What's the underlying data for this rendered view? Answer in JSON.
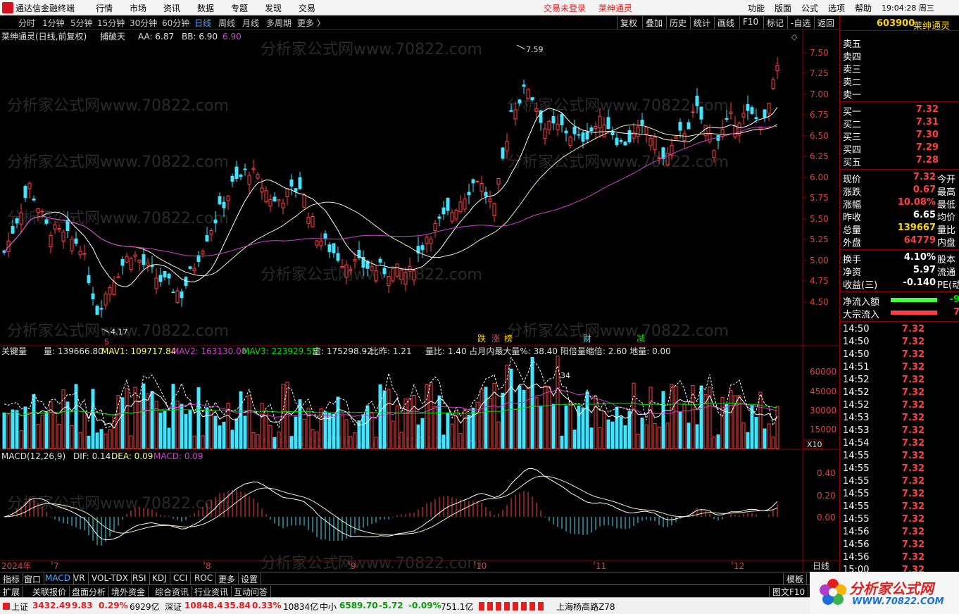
{
  "app": {
    "title": "通达信金融终端",
    "menu": [
      "行情",
      "市场",
      "资讯",
      "数据",
      "专题",
      "发现",
      "交易"
    ],
    "login_status": "交易未登录",
    "stock_name": "莱绅通灵",
    "right_menu": [
      "功能",
      "版面",
      "公式",
      "选项",
      "帮助"
    ],
    "time": "19:04:28",
    "weekday": "周三"
  },
  "toolbar": {
    "periods": [
      "分时",
      "1分钟",
      "5分钟",
      "15分钟",
      "30分钟",
      "60分钟",
      "日线",
      "周线",
      "月线",
      "多周期",
      "更多 〉"
    ],
    "active_period": "日线",
    "right_buttons": [
      "复权",
      "叠加",
      "历史",
      "统计",
      "画线",
      "F10",
      "标记",
      "-自选",
      "返回"
    ]
  },
  "main_chart": {
    "title": "莱绅通灵(日线,前复权)",
    "indicator": "捕破天",
    "aa_label": "AA: 6.87",
    "bb_label": "BB: 6.90",
    "extra_value": "6.90",
    "high_marker": "7.59",
    "low_marker": "4.17",
    "axis_labels": [
      "7.50",
      "7.25",
      "7.00",
      "6.75",
      "6.50",
      "6.25",
      "6.00",
      "5.75",
      "5.50",
      "5.25",
      "5.00",
      "4.75",
      "4.50"
    ],
    "markers": [
      "跌",
      "涨",
      "榜",
      "财",
      "减"
    ],
    "marker_s": "S",
    "watermark": "分析家公式网www.70822.com"
  },
  "volume_chart": {
    "title": "关键量",
    "vol": "量: 139666.80",
    "mav1": "MAV1: 109717.84",
    "mav2": "MAV2: 163130.00",
    "mav3": "MAV3: 223929.55",
    "xu": "虚: 175298.92",
    "ratio": "比昨: 1.21",
    "extra": "量比: 1.40  占月内最大量%: 38.40  阳倍量缩倍: 2.60  地量: 0.00",
    "axis_labels": [
      "60000",
      "45000",
      "30000",
      "15000"
    ],
    "scale": "X10",
    "annotation": "34"
  },
  "macd_chart": {
    "title": "MACD(12,26,9)",
    "dif": "DIF: 0.14",
    "dea": "DEA: 0.09",
    "macd": "MACD: 0.09",
    "axis_labels": [
      "0.40",
      "0.20",
      "0.00"
    ]
  },
  "date_axis": {
    "labels": [
      "2024年",
      "7",
      "8",
      "9",
      "10",
      "11",
      "12"
    ],
    "period_label": "日线"
  },
  "quote_panel": {
    "code": "603900",
    "name": "莱绅通灵",
    "sell_levels": [
      "卖五",
      "卖四",
      "卖三",
      "卖二",
      "卖一"
    ],
    "buy_levels": [
      {
        "label": "买一",
        "price": "7.32"
      },
      {
        "label": "买二",
        "price": "7.31"
      },
      {
        "label": "买三",
        "price": "7.30"
      },
      {
        "label": "买四",
        "price": "7.29"
      },
      {
        "label": "买五",
        "price": "7.28"
      }
    ],
    "stats": [
      {
        "label": "现价",
        "value": "7.32",
        "label2": "今开",
        "color": "red"
      },
      {
        "label": "涨跌",
        "value": "0.67",
        "label2": "最高",
        "color": "red"
      },
      {
        "label": "涨幅",
        "value": "10.08%",
        "label2": "最低",
        "color": "red"
      },
      {
        "label": "昨收",
        "value": "6.65",
        "label2": "均价",
        "color": "wht"
      },
      {
        "label": "总量",
        "value": "139667",
        "label2": "量比",
        "color": "yellow"
      },
      {
        "label": "外盘",
        "value": "64779",
        "label2": "内盘",
        "color": "red"
      }
    ],
    "stats2": [
      {
        "label": "换手",
        "value": "4.10%",
        "label2": "股本"
      },
      {
        "label": "净资",
        "value": "5.97",
        "label2": "流通"
      },
      {
        "label": "收益(三)",
        "value": "-0.140",
        "label2": "PE(动"
      }
    ],
    "flows": [
      {
        "label": "净流入额",
        "value": "-9"
      },
      {
        "label": "大宗流入",
        "value": "7"
      }
    ],
    "ticks": [
      {
        "time": "14:50",
        "price": "7.32"
      },
      {
        "time": "14:50",
        "price": "7.32"
      },
      {
        "time": "14:50",
        "price": "7.32"
      },
      {
        "time": "14:51",
        "price": "7.32"
      },
      {
        "time": "14:52",
        "price": "7.32"
      },
      {
        "time": "14:52",
        "price": "7.32"
      },
      {
        "time": "14:52",
        "price": "7.32"
      },
      {
        "time": "14:53",
        "price": "7.32"
      },
      {
        "time": "14:53",
        "price": "7.32"
      },
      {
        "time": "14:54",
        "price": "7.32"
      },
      {
        "time": "14:55",
        "price": "7.32"
      },
      {
        "time": "14:55",
        "price": "7.32"
      },
      {
        "time": "14:55",
        "price": "7.32"
      },
      {
        "time": "14:55",
        "price": "7.32"
      },
      {
        "time": "14:55",
        "price": "7.32"
      },
      {
        "time": "14:55",
        "price": "7.32"
      },
      {
        "time": "14:56",
        "price": "7.32"
      },
      {
        "time": "14:56",
        "price": "7.32"
      },
      {
        "time": "14:56",
        "price": "7.32"
      },
      {
        "time": "15:00",
        "price": "7.32"
      }
    ]
  },
  "bottom_tabs1": [
    "指标",
    "窗口",
    "MACD",
    "VR",
    "VOL-TDX",
    "RSI",
    "KDJ",
    "CCI",
    "ROC",
    "更多",
    "设置",
    "模板"
  ],
  "bottom_tabs2": [
    "扩展",
    "关联报价",
    "盘面分析",
    "境外资金",
    "综合资讯",
    "行业资讯",
    "互动问答",
    "图文F10"
  ],
  "status": {
    "sh_label": "上证",
    "sh_value": "3432.49",
    "sh_change": "9.83",
    "sh_pct": "0.29%",
    "sh_amount": "6929亿",
    "sz_label": "深证",
    "sz_value": "10848.4",
    "sz_change": "35.84",
    "sz_pct": "0.33%",
    "sz_amount": "10834亿",
    "zx_label": "中小",
    "zx_value": "6589.70",
    "zx_change": "-5.72",
    "zx_pct": "-0.09%",
    "zx_amount": "751.1亿",
    "server": "上海杨高路Z78"
  },
  "brand": {
    "name": "分析家公式网",
    "url": "WWW.70822.COM"
  },
  "colors": {
    "up": "#ff4040",
    "down": "#44e4ff",
    "ma1": "#ffffff",
    "ma2": "#f0f0c0",
    "ma3": "#d040d0",
    "accent": "#ffd700"
  }
}
